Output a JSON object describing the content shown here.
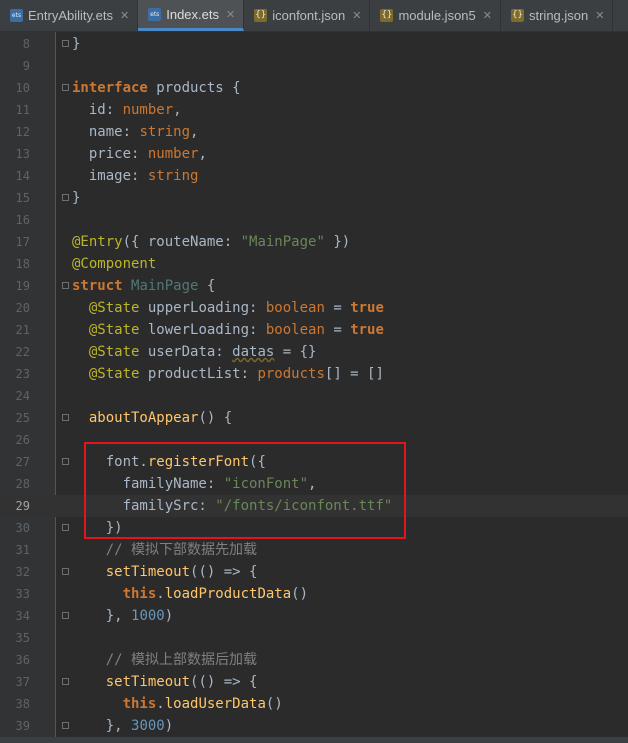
{
  "tabs": [
    {
      "name": "EntryAbility.ets",
      "type": "ets",
      "active": false
    },
    {
      "name": "Index.ets",
      "type": "ets",
      "active": true
    },
    {
      "name": "iconfont.json",
      "type": "json",
      "active": false
    },
    {
      "name": "module.json5",
      "type": "json",
      "active": false
    },
    {
      "name": "string.json",
      "type": "json",
      "active": false
    }
  ],
  "close_glyph": "✕",
  "colors": {
    "background": "#2b2b2b",
    "keyword": "#cc7832",
    "string": "#6a8759",
    "number": "#6897bb",
    "decorator": "#bbb529",
    "function": "#ffc66d",
    "comment": "#808080",
    "highlight_box": "#e0161d"
  },
  "lines": [
    {
      "n": 8,
      "fold": true,
      "segs": [
        [
          "}",
          "p"
        ]
      ]
    },
    {
      "n": 9,
      "segs": []
    },
    {
      "n": 10,
      "fold": true,
      "segs": [
        [
          "interface",
          "k"
        ],
        [
          " products ",
          "p"
        ],
        [
          "{",
          "p"
        ]
      ]
    },
    {
      "n": 11,
      "segs": [
        [
          "  id",
          "p"
        ],
        [
          ": ",
          "p"
        ],
        [
          "number",
          "k"
        ],
        [
          ",",
          "p"
        ]
      ]
    },
    {
      "n": 12,
      "segs": [
        [
          "  name",
          "p"
        ],
        [
          ": ",
          "p"
        ],
        [
          "string",
          "k"
        ],
        [
          ",",
          "p"
        ]
      ]
    },
    {
      "n": 13,
      "segs": [
        [
          "  price",
          "p"
        ],
        [
          ": ",
          "p"
        ],
        [
          "number",
          "k"
        ],
        [
          ",",
          "p"
        ]
      ]
    },
    {
      "n": 14,
      "segs": [
        [
          "  image",
          "p"
        ],
        [
          ": ",
          "p"
        ],
        [
          "string",
          "k"
        ]
      ]
    },
    {
      "n": 15,
      "fold": true,
      "segs": [
        [
          "}",
          "p"
        ]
      ]
    },
    {
      "n": 16,
      "segs": []
    },
    {
      "n": 17,
      "segs": [
        [
          "@Entry",
          "d"
        ],
        [
          "({ routeName: ",
          "p"
        ],
        [
          "\"MainPage\"",
          "s"
        ],
        [
          " })",
          "p"
        ]
      ]
    },
    {
      "n": 18,
      "segs": [
        [
          "@Component",
          "d"
        ]
      ]
    },
    {
      "n": 19,
      "fold": true,
      "segs": [
        [
          "struct",
          "k"
        ],
        [
          " ",
          "p"
        ],
        [
          "MainPage",
          "t"
        ],
        [
          " {",
          "p"
        ]
      ]
    },
    {
      "n": 20,
      "segs": [
        [
          "  ",
          "p"
        ],
        [
          "@State",
          "d"
        ],
        [
          " upperLoading: ",
          "p"
        ],
        [
          "boolean",
          "k"
        ],
        [
          " = ",
          "p"
        ],
        [
          "true",
          "k"
        ]
      ]
    },
    {
      "n": 21,
      "segs": [
        [
          "  ",
          "p"
        ],
        [
          "@State",
          "d"
        ],
        [
          " lowerLoading: ",
          "p"
        ],
        [
          "boolean",
          "k"
        ],
        [
          " = ",
          "p"
        ],
        [
          "true",
          "k"
        ]
      ]
    },
    {
      "n": 22,
      "segs": [
        [
          "  ",
          "p"
        ],
        [
          "@State",
          "d"
        ],
        [
          " userData: ",
          "p"
        ],
        [
          "datas",
          "w"
        ],
        [
          " = {}",
          "p"
        ]
      ]
    },
    {
      "n": 23,
      "segs": [
        [
          "  ",
          "p"
        ],
        [
          "@State",
          "d"
        ],
        [
          " productList: ",
          "p"
        ],
        [
          "products",
          "k"
        ],
        [
          "[] = []",
          "p"
        ]
      ]
    },
    {
      "n": 24,
      "segs": []
    },
    {
      "n": 25,
      "fold": true,
      "segs": [
        [
          "  ",
          "p"
        ],
        [
          "aboutToAppear",
          "f"
        ],
        [
          "() {",
          "p"
        ]
      ]
    },
    {
      "n": 26,
      "segs": []
    },
    {
      "n": 27,
      "fold": true,
      "segs": [
        [
          "    font.",
          "p"
        ],
        [
          "registerFont",
          "f"
        ],
        [
          "({",
          "p"
        ]
      ]
    },
    {
      "n": 28,
      "segs": [
        [
          "      familyName: ",
          "p"
        ],
        [
          "\"iconFont\"",
          "s"
        ],
        [
          ",",
          "p"
        ]
      ]
    },
    {
      "n": 29,
      "current": true,
      "segs": [
        [
          "      familySrc: ",
          "p"
        ],
        [
          "\"/fonts/iconfont.ttf\"",
          "s"
        ]
      ]
    },
    {
      "n": 30,
      "fold": true,
      "segs": [
        [
          "    })",
          "p"
        ]
      ]
    },
    {
      "n": 31,
      "segs": [
        [
          "    // 模拟下部数据先加载",
          "c"
        ]
      ]
    },
    {
      "n": 32,
      "fold": true,
      "segs": [
        [
          "    ",
          "p"
        ],
        [
          "setTimeout",
          "f"
        ],
        [
          "(() => {",
          "p"
        ]
      ]
    },
    {
      "n": 33,
      "segs": [
        [
          "      ",
          "p"
        ],
        [
          "this",
          "k"
        ],
        [
          ".",
          "p"
        ],
        [
          "loadProductData",
          "f"
        ],
        [
          "()",
          "p"
        ]
      ]
    },
    {
      "n": 34,
      "fold": true,
      "segs": [
        [
          "    }, ",
          "p"
        ],
        [
          "1000",
          "n"
        ],
        [
          ")",
          "p"
        ]
      ]
    },
    {
      "n": 35,
      "segs": []
    },
    {
      "n": 36,
      "segs": [
        [
          "    // 模拟上部数据后加载",
          "c"
        ]
      ]
    },
    {
      "n": 37,
      "fold": true,
      "segs": [
        [
          "    ",
          "p"
        ],
        [
          "setTimeout",
          "f"
        ],
        [
          "(() => {",
          "p"
        ]
      ]
    },
    {
      "n": 38,
      "segs": [
        [
          "      ",
          "p"
        ],
        [
          "this",
          "k"
        ],
        [
          ".",
          "p"
        ],
        [
          "loadUserData",
          "f"
        ],
        [
          "()",
          "p"
        ]
      ]
    },
    {
      "n": 39,
      "fold": true,
      "segs": [
        [
          "    }, ",
          "p"
        ],
        [
          "3000",
          "n"
        ],
        [
          ")",
          "p"
        ]
      ]
    }
  ]
}
